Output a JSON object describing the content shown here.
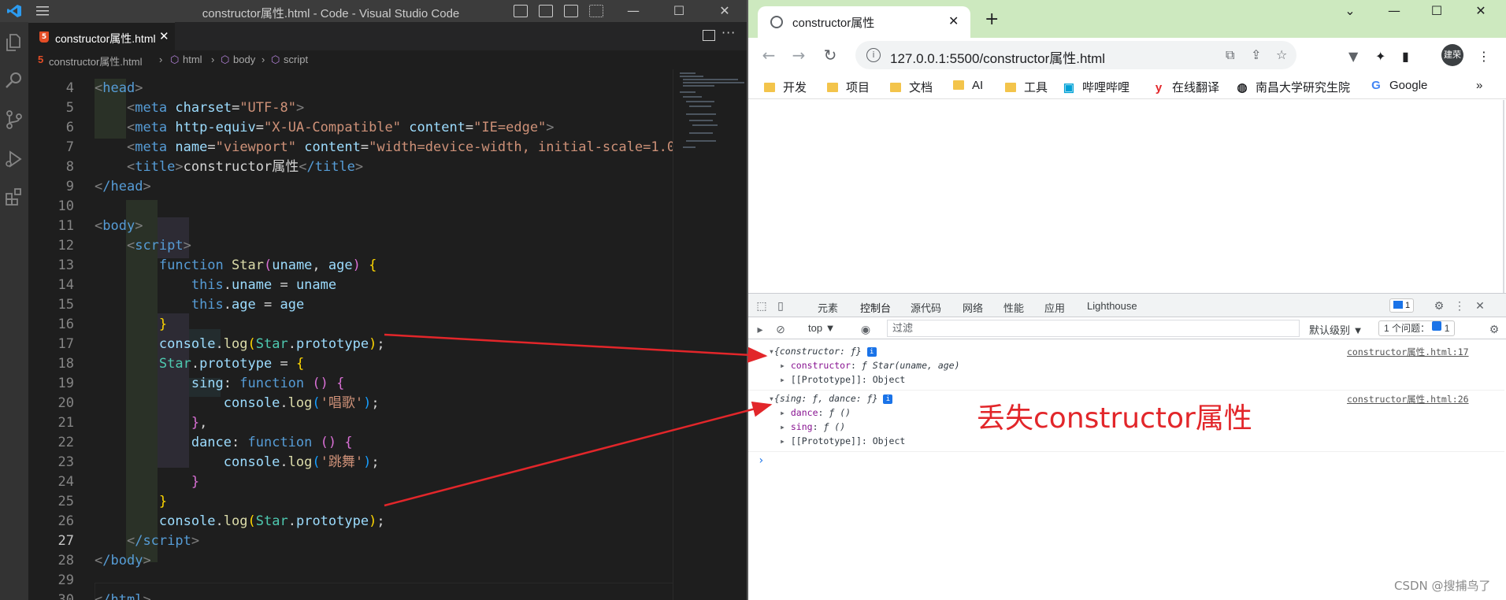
{
  "vscode": {
    "window_title": "constructor属性.html - Code - Visual Studio Code",
    "tab": {
      "filename": "constructor属性.html",
      "close_glyph": "✕",
      "icon_letter": "5"
    },
    "breadcrumb": [
      "constructor属性.html",
      "html",
      "body",
      "script"
    ],
    "controls": {
      "minimize": "—",
      "maximize": "☐",
      "close": "✕"
    },
    "active_line": 27
  },
  "code_lines": [
    {
      "n": "4"
    },
    {
      "n": "5"
    },
    {
      "n": "6"
    },
    {
      "n": "7"
    },
    {
      "n": "8"
    },
    {
      "n": "9"
    },
    {
      "n": "10"
    },
    {
      "n": "11"
    },
    {
      "n": "12"
    },
    {
      "n": "13"
    },
    {
      "n": "14"
    },
    {
      "n": "15"
    },
    {
      "n": "16"
    },
    {
      "n": "17"
    },
    {
      "n": "18"
    },
    {
      "n": "19"
    },
    {
      "n": "20"
    },
    {
      "n": "21"
    },
    {
      "n": "22"
    },
    {
      "n": "23"
    },
    {
      "n": "24"
    },
    {
      "n": "25"
    },
    {
      "n": "26"
    },
    {
      "n": "27"
    },
    {
      "n": "28"
    },
    {
      "n": "29"
    },
    {
      "n": "30"
    }
  ],
  "code": {
    "l4": {
      "tag": "head"
    },
    "l5": {
      "tag": "meta",
      "attr": "charset",
      "val": "\"UTF-8\""
    },
    "l6": {
      "tag": "meta",
      "attr1": "http-equiv",
      "val1": "\"X-UA-Compatible\"",
      "attr2": "content",
      "val2": "\"IE=edge\""
    },
    "l7": {
      "tag": "meta",
      "attr1": "name",
      "val1": "\"viewport\"",
      "attr2": "content",
      "val2": "\"width=device-width, initial-scale=1.0"
    },
    "l8": {
      "tag": "title",
      "text": "constructor属性",
      "close": "/title"
    },
    "l9": {
      "tag": "/head"
    },
    "l11": {
      "tag": "body"
    },
    "l12": {
      "tag": "script"
    },
    "l13": {
      "kw": "function",
      "fn": "Star",
      "p1": "uname",
      "p2": "age"
    },
    "l14": {
      "kw": "this",
      "prop": "uname",
      "rhs": "uname"
    },
    "l15": {
      "kw": "this",
      "prop": "age",
      "rhs": "age"
    },
    "l17": {
      "obj": "console",
      "fn": "log",
      "cls": "Star",
      "prop": "prototype"
    },
    "l18": {
      "cls": "Star",
      "prop": "prototype"
    },
    "l19": {
      "fn": "sing",
      "kw": "function"
    },
    "l20": {
      "obj": "console",
      "fn": "log",
      "str": "'唱歌'"
    },
    "l22": {
      "fn": "dance",
      "kw": "function"
    },
    "l23": {
      "obj": "console",
      "fn": "log",
      "str": "'跳舞'"
    },
    "l26": {
      "obj": "console",
      "fn": "log",
      "cls": "Star",
      "prop": "prototype"
    },
    "l27": {
      "tag": "/script"
    },
    "l28": {
      "tag": "/body"
    },
    "l30": {
      "tag": "/html"
    }
  },
  "browser": {
    "tab_title": "constructor属性",
    "url": "127.0.0.1:5500/constructor属性.html",
    "avatar": "建荣",
    "bookmarks": [
      "开发",
      "项目",
      "文档",
      "AI",
      "工具",
      "哔哩哔哩",
      "在线翻译",
      "南昌大学研究生院",
      "Google"
    ],
    "bookmark_more": "»",
    "controls": {
      "collapse": "⌄",
      "minimize": "—",
      "maximize": "☐",
      "close": "✕"
    }
  },
  "devtools": {
    "tabs": [
      "元素",
      "控制台",
      "源代码",
      "网络",
      "性能",
      "应用",
      "Lighthouse"
    ],
    "active_tab": "控制台",
    "issue_badge": "1",
    "context": "top ▼",
    "filter_placeholder": "过滤",
    "levels": "默认级别 ▼",
    "issues": "1 个问题：",
    "issues_count": "1"
  },
  "console": {
    "entry1": {
      "summary": "{constructor: ƒ}",
      "source": "constructor属性.html:17",
      "rows": [
        {
          "key": "constructor",
          "value": "ƒ Star(uname, age)"
        },
        {
          "key": "[[Prototype]]",
          "value": "Object"
        }
      ]
    },
    "entry2": {
      "summary": "{sing: ƒ, dance: ƒ}",
      "source": "constructor属性.html:26",
      "rows": [
        {
          "key": "dance",
          "value": "ƒ ()"
        },
        {
          "key": "sing",
          "value": "ƒ ()"
        },
        {
          "key": "[[Prototype]]",
          "value": "Object"
        }
      ]
    },
    "prompt": "›"
  },
  "annotation": "丢失constructor属性",
  "watermark": "CSDN @搜捕鸟了",
  "colors": {
    "annotation_red": "#e2262a",
    "tabstrip_green": "#cde9bf",
    "vscode_bg": "#1e1e1e"
  }
}
